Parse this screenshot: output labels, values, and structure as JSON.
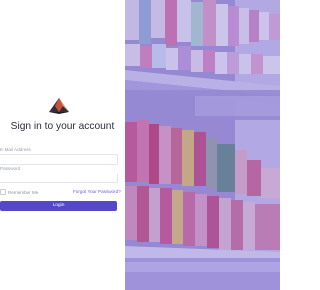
{
  "brand": {
    "logo_icon": "pyramid-logo-icon"
  },
  "login": {
    "title": "Sign in to your account",
    "email_label": "E-Mail Address",
    "email_value": "",
    "password_label": "Password",
    "password_value": "",
    "remember_label": "Remember Me",
    "remember_checked": false,
    "forgot_label": "Forgot Your Password?",
    "submit_label": "Login"
  },
  "hero_image": {
    "subject": "supermarket shelves",
    "tint_color": "#6858d2"
  },
  "colors": {
    "accent": "#5548c8",
    "link": "#6a5fd1",
    "title": "#2a2e3b",
    "muted": "#9aa0ad"
  }
}
